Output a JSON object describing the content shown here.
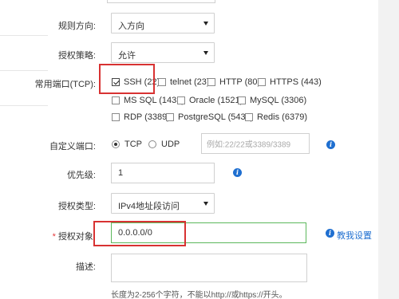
{
  "form": {
    "direction": {
      "label": "规则方向:",
      "value": "入方向"
    },
    "policy": {
      "label": "授权策略:",
      "value": "允许"
    },
    "common_ports": {
      "label": "常用端口(TCP):",
      "options": [
        {
          "label": "SSH (22)",
          "checked": true
        },
        {
          "label": "telnet (23)",
          "checked": false
        },
        {
          "label": "HTTP (80)",
          "checked": false
        },
        {
          "label": "HTTPS (443)",
          "checked": false
        },
        {
          "label": "MS SQL (1433)",
          "checked": false
        },
        {
          "label": "Oracle (1521)",
          "checked": false
        },
        {
          "label": "MySQL (3306)",
          "checked": false
        },
        {
          "label": "RDP (3389)",
          "checked": false
        },
        {
          "label": "PostgreSQL (5432)",
          "checked": false
        },
        {
          "label": "Redis (6379)",
          "checked": false
        }
      ]
    },
    "custom_port": {
      "label": "自定义端口:",
      "protocols": [
        {
          "label": "TCP",
          "selected": true
        },
        {
          "label": "UDP",
          "selected": false
        }
      ],
      "placeholder": "例如:22/22或3389/3389"
    },
    "priority": {
      "label": "优先级:",
      "value": "1"
    },
    "auth_type": {
      "label": "授权类型:",
      "value": "IPv4地址段访问"
    },
    "auth_object": {
      "required_mark": "*",
      "label": "授权对象:",
      "value": "0.0.0.0/0",
      "help_link": "教我设置"
    },
    "description": {
      "label": "描述:",
      "hint": "长度为2-256个字符，不能以http://或https://开头。"
    }
  },
  "colors": {
    "accent": "#1f6fd0",
    "highlight_box": "#d83232",
    "valid_border": "#5cb85c"
  },
  "icons": {
    "info": "info-icon"
  }
}
